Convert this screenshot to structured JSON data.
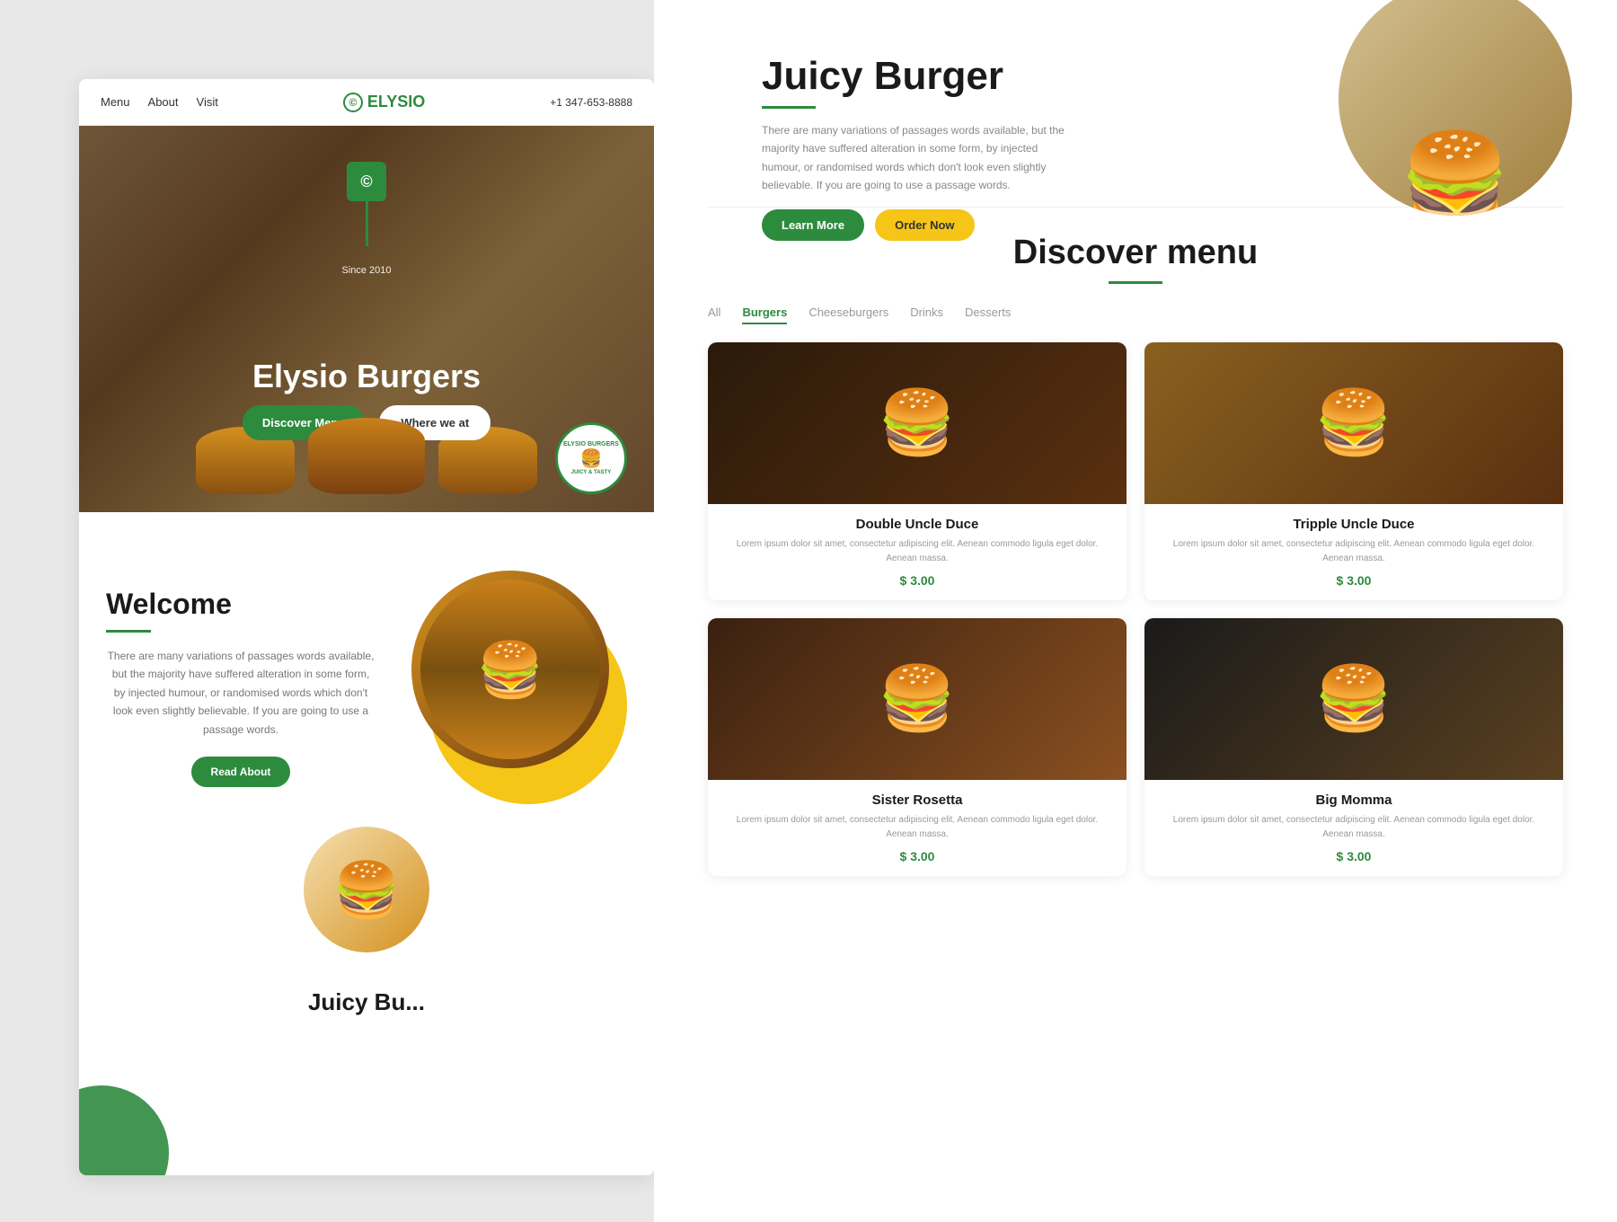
{
  "navbar": {
    "menu": "Menu",
    "about": "About",
    "visit": "Visit",
    "logo_text": "ELYSIO",
    "logo_icon": "©",
    "phone": "+1 347-653-8888"
  },
  "hero": {
    "since": "Since 2010",
    "title": "Elysio Burgers",
    "discover_btn": "Discover Menu",
    "where_btn": "Where we at",
    "badge_line1": "ELYSIO BURGERS",
    "badge_icon": "🍔",
    "badge_line2": "JUICY & TASTY"
  },
  "welcome": {
    "title": "Welcome",
    "description": "There are many variations of passages words available, but the majority have suffered alteration in some form, by injected humour, or randomised words which don't look even slightly believable. If you are going to use a passage words.",
    "read_about_btn": "Read About"
  },
  "juicy_top": {
    "title": "Juicy Burger",
    "description": "There are many variations of passages words available, but the majority have suffered alteration in some form, by injected humour, or randomised words which don't look even slightly believable. If you are going to use a passage words.",
    "learn_more_btn": "Learn More",
    "order_now_btn": "Order Now"
  },
  "discover": {
    "title": "Discover menu",
    "tabs": [
      "All",
      "Burgers",
      "Cheeseburgers",
      "Drinks",
      "Desserts"
    ],
    "active_tab": "Burgers"
  },
  "menu_items": [
    {
      "name": "Double Uncle Duce",
      "description": "Lorem ipsum dolor sit amet, consectetur adipiscing elit. Aenean commodo ligula eget dolor. Aenean massa.",
      "price": "$ 3.00",
      "color_class": "c1"
    },
    {
      "name": "Tripple Uncle Duce",
      "description": "Lorem ipsum dolor sit amet, consectetur adipiscing elit. Aenean commodo ligula eget dolor. Aenean massa.",
      "price": "$ 3.00",
      "color_class": "c2"
    },
    {
      "name": "Sister Rosetta",
      "description": "Lorem ipsum dolor sit amet, consectetur adipiscing elit. Aenean commodo ligula eget dolor. Aenean massa.",
      "price": "$ 3.00",
      "color_class": "c3"
    },
    {
      "name": "Big Momma",
      "description": "Lorem ipsum dolor sit amet, consectetur adipiscing elit. Aenean commodo ligula eget dolor. Aenean massa.",
      "price": "$ 3.00",
      "color_class": "c4"
    }
  ],
  "colors": {
    "green": "#2d8b3e",
    "yellow": "#f5c518",
    "dark": "#1a1a1a",
    "gray": "#888888"
  }
}
